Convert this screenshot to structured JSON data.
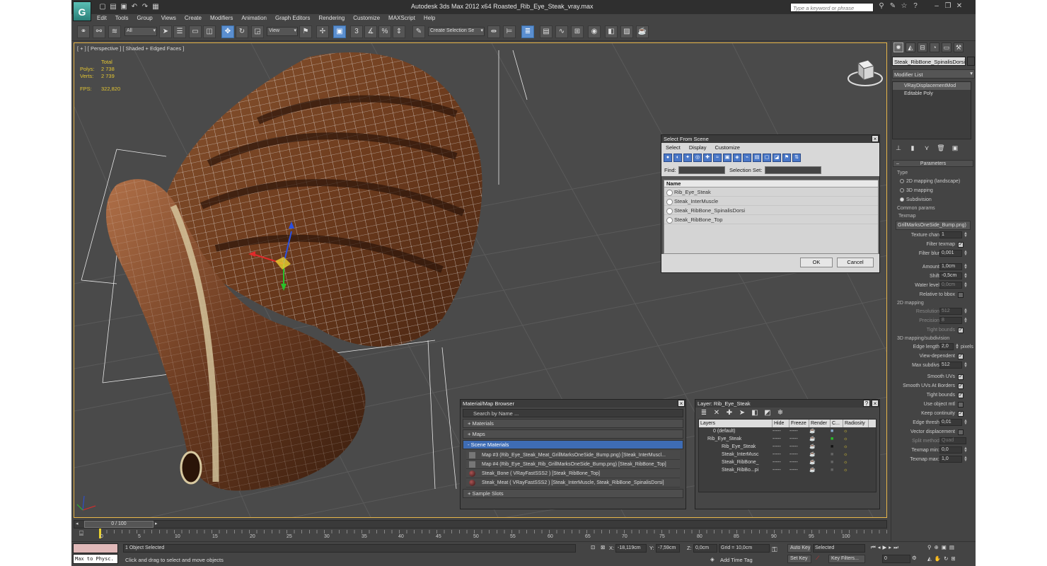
{
  "window": {
    "title": "Autodesk 3ds Max  2012 x64     Roasted_Rib_Eye_Steak_vray.max",
    "search_placeholder": "Type a keyword or phrase"
  },
  "menu": [
    "Edit",
    "Tools",
    "Group",
    "Views",
    "Create",
    "Modifiers",
    "Animation",
    "Graph Editors",
    "Rendering",
    "Customize",
    "MAXScript",
    "Help"
  ],
  "toolbar": {
    "filter_dropdown": "All",
    "ref_coord_dropdown": "View",
    "selection_set_dropdown": "Create Selection Se"
  },
  "viewport": {
    "label": "[ + ] [ Perspective ] [ Shaded + Edged Faces ]",
    "stats": {
      "total_label": "Total",
      "polys_label": "Polys:",
      "polys_value": "2 738",
      "verts_label": "Verts:",
      "verts_value": "2 739",
      "fps_label": "FPS:",
      "fps_value": "322,820"
    }
  },
  "command_panel": {
    "object_name": "Steak_RibBone_SpinalisDorsi",
    "modifier_list": "Modifier List",
    "stack": [
      "VRayDisplacementMod",
      "Editable Poly"
    ],
    "parameters_title": "Parameters",
    "type_label": "Type",
    "type_options": [
      "2D mapping (landscape)",
      "3D mapping",
      "Subdivision"
    ],
    "common_params": "Common params",
    "texmap_label": "Texmap",
    "texmap_value": "GrillMarksOneSide_Bump.png)",
    "texture_chan_label": "Texture chan",
    "texture_chan_value": "1",
    "filter_texmap_label": "Filter texmap",
    "filter_blur_label": "Filter blur",
    "filter_blur_value": "0,001",
    "amount_label": "Amount",
    "amount_value": "1,0cm",
    "shift_label": "Shift",
    "shift_value": "-0,5cm",
    "water_level_label": "Water level",
    "water_level_value": "0,0cm",
    "relative_bbox_label": "Relative to bbox",
    "mapping2d_title": "2D mapping",
    "resolution_label": "Resolution",
    "resolution_value": "512",
    "precision_label": "Precision",
    "precision_value": "8",
    "tight_bounds_label": "Tight bounds",
    "mapping3d_title": "3D mapping/subdivision",
    "edge_length_label": "Edge length",
    "edge_length_value": "2,0",
    "edge_length_unit": "pixels",
    "view_dependent_label": "View-dependent",
    "max_subdivs_label": "Max subdivs",
    "max_subdivs_value": "512",
    "smooth_uvs_label": "Smooth UVs",
    "smooth_uvs_borders_label": "Smooth UVs At Borders",
    "tight_bounds2_label": "Tight bounds",
    "use_object_mtl_label": "Use object mtl",
    "keep_continuity_label": "Keep continuity",
    "edge_thresh_label": "Edge thresh",
    "edge_thresh_value": "0,01",
    "vector_disp_label": "Vector displacement",
    "split_method_label": "Split method",
    "split_method_value": "Quad",
    "texmap_min_label": "Texmap min:",
    "texmap_min_value": "0,0",
    "texmap_max_label": "Texmap max:",
    "texmap_max_value": "1,0"
  },
  "select_from_scene": {
    "title": "Select From Scene",
    "menu": [
      "Select",
      "Display",
      "Customize"
    ],
    "find_label": "Find:",
    "selection_set_label": "Selection Set:",
    "column_name": "Name",
    "items": [
      "Rib_Eye_Steak",
      "Steak_InterMuscle",
      "Steak_RibBone_SpinalisDorsi",
      "Steak_RibBone_Top"
    ],
    "ok": "OK",
    "cancel": "Cancel"
  },
  "material_browser": {
    "title": "Material/Map Browser",
    "search": "Search by Name ...",
    "groups": [
      "+ Materials",
      "+ Maps",
      "- Scene Materials",
      "+ Sample Slots"
    ],
    "items": [
      "Map #3 (Rib_Eye_Steak_Meat_GrillMarksOneSide_Bump.png) [Steak_InterMuscl...",
      "Map #4 (Rib_Eye_Steak_Rib_GrillMarksOneSide_Bump.png) [Steak_RibBone_Top]",
      "Steak_Bone ( VRayFastSSS2 ) [Steak_RibBone_Top]",
      "Steak_Meat ( VRayFastSSS2 ) [Steak_InterMuscle, Steak_RibBone_SpinalisDorsi]"
    ]
  },
  "layer_dialog": {
    "title": "Layer: Rib_Eye_Steak",
    "columns": [
      "Layers",
      "Hide",
      "Freeze",
      "Render",
      "C...",
      "Radiosity"
    ],
    "rows": [
      "0 (default)",
      "Rib_Eye_Steak",
      "Rib_Eye_Steak",
      "Steak_InterMusc",
      "Steak_RibBone_",
      "Steak_RibBo...pi"
    ],
    "dots": "-----"
  },
  "timeline": {
    "frame": "0 / 100",
    "ticks": [
      "0",
      "5",
      "10",
      "15",
      "20",
      "25",
      "30",
      "35",
      "40",
      "45",
      "50",
      "55",
      "60",
      "65",
      "70",
      "75",
      "80",
      "85",
      "90",
      "95",
      "100"
    ]
  },
  "status": {
    "maxscript_label": "Max to Physc.",
    "selected": "1 Object Selected",
    "prompt": "Click and drag to select and move objects",
    "x_label": "X:",
    "x_value": "-18,119cm",
    "y_label": "Y:",
    "y_value": "-7,59cm",
    "z_label": "Z:",
    "z_value": "0,0cm",
    "grid": "Grid = 10,0cm",
    "add_time_tag": "Add Time Tag",
    "auto_key": "Auto Key",
    "set_key": "Set Key",
    "selected_dropdown": "Selected",
    "key_filters": "Key Filters...",
    "frame_value": "0"
  }
}
